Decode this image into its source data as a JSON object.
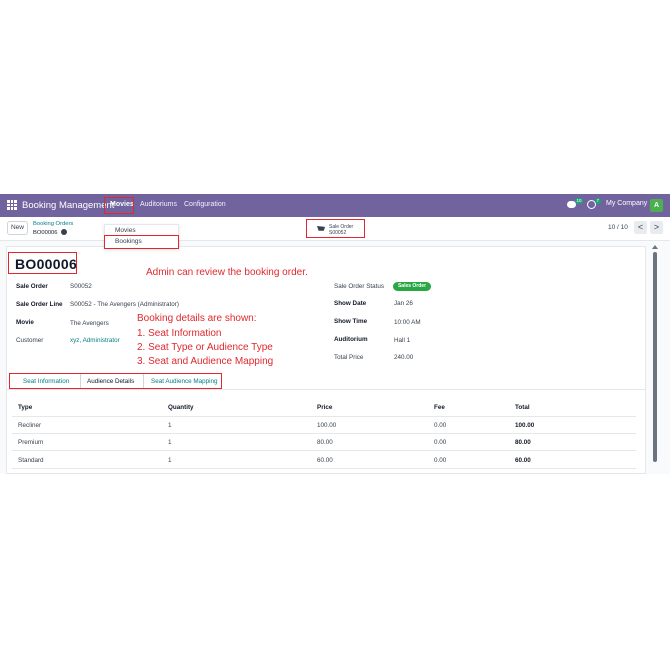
{
  "navbar": {
    "app_name": "Booking Management",
    "menus": [
      "Movies",
      "Auditoriums",
      "Configuration"
    ],
    "chat_badge": "10",
    "activity_badge": "7",
    "company": "My Company",
    "avatar_letter": "A"
  },
  "control_panel": {
    "new_label": "New",
    "breadcrumb_parent": "Booking Orders",
    "breadcrumb_current": "BO00006",
    "pager": "10 / 10",
    "prev": "<",
    "next": ">"
  },
  "dropdown": {
    "items": [
      "Movies",
      "Bookings"
    ]
  },
  "smart_button": {
    "label": "Sale Order",
    "value": "S00052"
  },
  "record": {
    "title": "BO00006",
    "left_fields": [
      {
        "label": "Sale Order",
        "value": "S00052"
      },
      {
        "label": "Sale Order Line",
        "value": "S00052 - The Avengers (Administrator)"
      },
      {
        "label": "Movie",
        "value": "The Avengers"
      },
      {
        "label": "Customer",
        "value": "xyz, Administrator"
      }
    ],
    "right_fields": [
      {
        "label": "Sale Order Status",
        "value": "Sales Order"
      },
      {
        "label": "Show Date",
        "value": "Jan 26"
      },
      {
        "label": "Show Time",
        "value": "10:00 AM"
      },
      {
        "label": "Auditorium",
        "value": "Hall 1"
      },
      {
        "label": "Total Price",
        "value": "240.00"
      }
    ]
  },
  "annotations": {
    "review": "Admin can review the booking order.",
    "details_title": "Booking details are shown:",
    "details_1": "1. Seat Information",
    "details_2": "2. Seat Type or Audience Type",
    "details_3": "3. Seat and Audience Mapping"
  },
  "tabs": [
    "Seat Information",
    "Audience Details",
    "Seat Audience Mapping"
  ],
  "table": {
    "headers": [
      "Type",
      "Quantity",
      "Price",
      "Fee",
      "Total"
    ],
    "rows": [
      [
        "Recliner",
        "1",
        "100.00",
        "0.00",
        "100.00"
      ],
      [
        "Premium",
        "1",
        "80.00",
        "0.00",
        "80.00"
      ],
      [
        "Standard",
        "1",
        "60.00",
        "0.00",
        "60.00"
      ]
    ]
  },
  "colors": {
    "navbar": "#71639e",
    "highlight": "#e0282e",
    "link": "#017e84",
    "status_badge": "#28a745"
  }
}
